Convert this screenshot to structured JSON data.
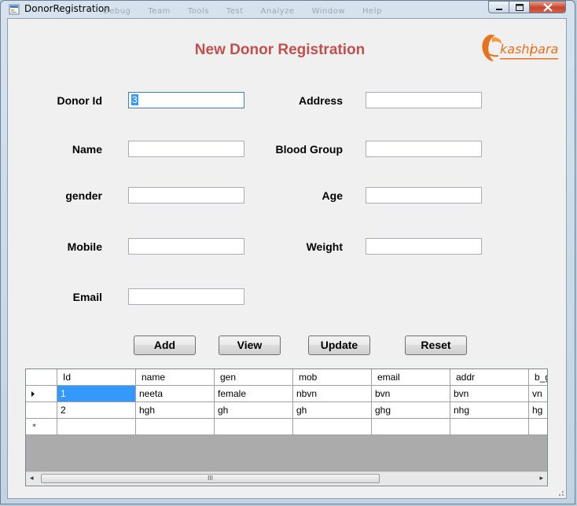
{
  "window": {
    "title": "DonorRegistration",
    "ghost_menu": [
      "Debug",
      "Team",
      "Tools",
      "Test",
      "Analyze",
      "Window",
      "Help"
    ]
  },
  "form": {
    "heading": "New Donor Registration",
    "logo_text_left": "kashi",
    "logo_text_right": "para",
    "fields": {
      "donor_id": {
        "label": "Donor Id",
        "value": "3"
      },
      "name": {
        "label": "Name",
        "value": ""
      },
      "gender": {
        "label": "gender",
        "value": ""
      },
      "mobile": {
        "label": "Mobile",
        "value": ""
      },
      "email": {
        "label": "Email",
        "value": ""
      },
      "address": {
        "label": "Address",
        "value": ""
      },
      "blood_group": {
        "label": "Blood Group",
        "value": ""
      },
      "age": {
        "label": "Age",
        "value": ""
      },
      "weight": {
        "label": "Weight",
        "value": ""
      }
    },
    "buttons": {
      "add": "Add",
      "view": "View",
      "update": "Update",
      "reset": "Reset"
    }
  },
  "grid": {
    "columns": [
      "Id",
      "name",
      "gen",
      "mob",
      "email",
      "addr",
      "b_g"
    ],
    "rows": [
      [
        "1",
        "neeta",
        "female",
        "nbvn",
        "bvn",
        "bvn",
        "vn"
      ],
      [
        "2",
        "hgh",
        "gh",
        "gh",
        "ghg",
        "nhg",
        "hg"
      ],
      [
        "",
        "",
        "",
        "",
        "",
        "",
        ""
      ]
    ],
    "new_row_marker": "*",
    "scroll_grip": "III",
    "colors": {
      "selected": "#3399ff",
      "empty_area": "#ababab"
    }
  },
  "colors": {
    "heading": "#c0504d",
    "logo_orange": "#e8711c"
  }
}
